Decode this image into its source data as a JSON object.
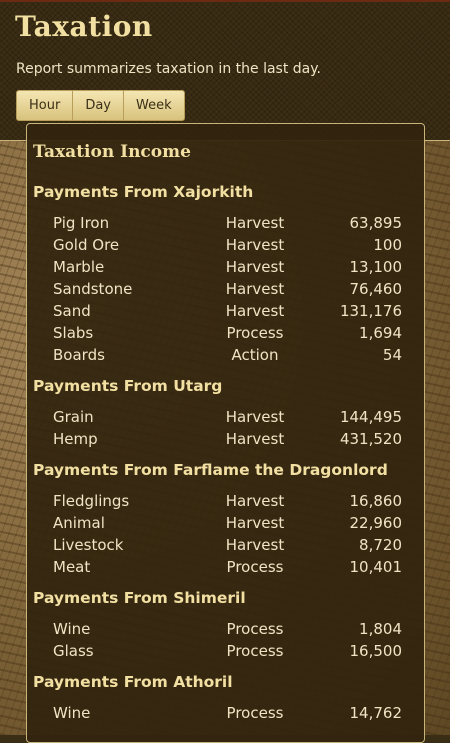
{
  "header": {
    "title": "Taxation",
    "subtitle": "Report summarizes taxation in the last day.",
    "buttons": [
      "Hour",
      "Day",
      "Week"
    ]
  },
  "panel": {
    "title": "Taxation Income",
    "groups": [
      {
        "title": "Payments From Xajorkith",
        "rows": [
          {
            "name": "Pig Iron",
            "type": "Harvest",
            "value": "63,895"
          },
          {
            "name": "Gold Ore",
            "type": "Harvest",
            "value": "100"
          },
          {
            "name": "Marble",
            "type": "Harvest",
            "value": "13,100"
          },
          {
            "name": "Sandstone",
            "type": "Harvest",
            "value": "76,460"
          },
          {
            "name": "Sand",
            "type": "Harvest",
            "value": "131,176"
          },
          {
            "name": "Slabs",
            "type": "Process",
            "value": "1,694"
          },
          {
            "name": "Boards",
            "type": "Action",
            "value": "54"
          }
        ]
      },
      {
        "title": "Payments From Utarg",
        "rows": [
          {
            "name": "Grain",
            "type": "Harvest",
            "value": "144,495"
          },
          {
            "name": "Hemp",
            "type": "Harvest",
            "value": "431,520"
          }
        ]
      },
      {
        "title": "Payments From Farflame the Dragonlord",
        "rows": [
          {
            "name": "Fledglings",
            "type": "Harvest",
            "value": "16,860"
          },
          {
            "name": "Animal",
            "type": "Harvest",
            "value": "22,960"
          },
          {
            "name": "Livestock",
            "type": "Harvest",
            "value": "8,720"
          },
          {
            "name": "Meat",
            "type": "Process",
            "value": "10,401"
          }
        ]
      },
      {
        "title": "Payments From Shimeril",
        "rows": [
          {
            "name": "Wine",
            "type": "Process",
            "value": "1,804"
          },
          {
            "name": "Glass",
            "type": "Process",
            "value": "16,500"
          }
        ]
      },
      {
        "title": "Payments From Athoril",
        "rows": [
          {
            "name": "Wine",
            "type": "Process",
            "value": "14,762"
          }
        ]
      }
    ]
  }
}
